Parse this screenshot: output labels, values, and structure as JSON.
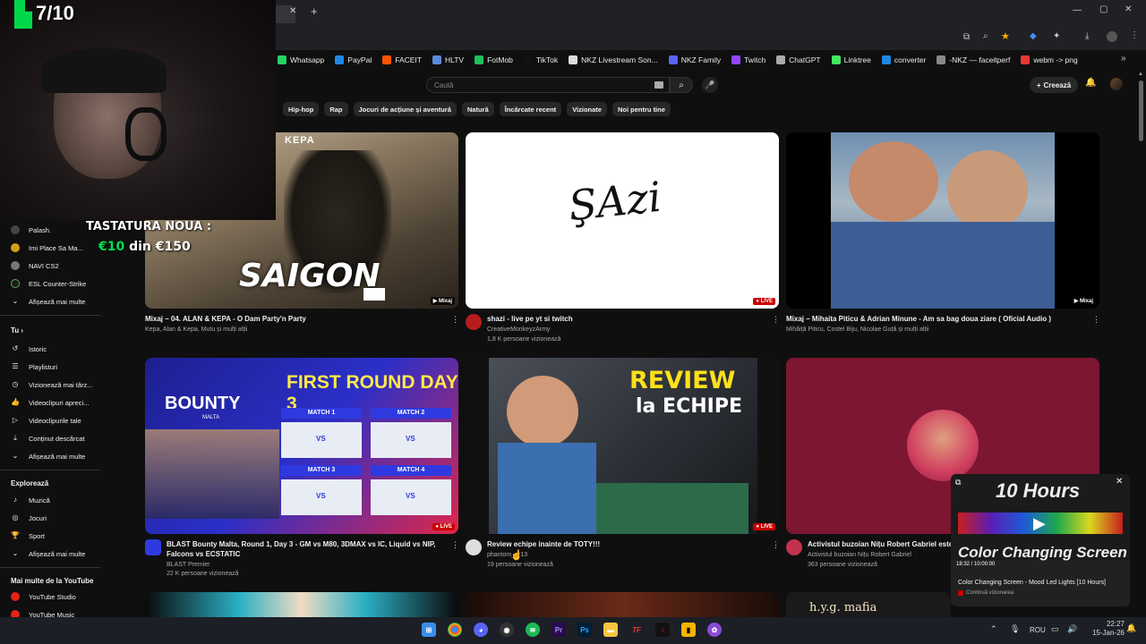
{
  "overlay": {
    "counter": "7/10",
    "keyboard_label": "TASTATURA NOUA :",
    "keyboard_amount": "€10",
    "keyboard_of": "din €150"
  },
  "browser": {
    "bookmarks": [
      {
        "label": "Whatsapp",
        "color": "#25d366"
      },
      {
        "label": "PayPal",
        "color": "#1e88e5"
      },
      {
        "label": "FACEIT",
        "color": "#ff5500"
      },
      {
        "label": "HLTV",
        "color": "#5b8bd9"
      },
      {
        "label": "FotMob",
        "color": "#20c05c"
      },
      {
        "label": "TikTok",
        "color": "#111111"
      },
      {
        "label": "NKZ Livestream Son...",
        "color": "#dddddd"
      },
      {
        "label": "NKZ Family",
        "color": "#5865f2"
      },
      {
        "label": "Twitch",
        "color": "#9146ff"
      },
      {
        "label": "ChatGPT",
        "color": "#aaaaaa"
      },
      {
        "label": "Linktree",
        "color": "#43e660"
      },
      {
        "label": "converter",
        "color": "#1e88e5"
      },
      {
        "label": "-NKZ — faceitperf",
        "color": "#888888"
      },
      {
        "label": "webm -> png",
        "color": "#e53935"
      }
    ]
  },
  "header": {
    "search_placeholder": "Caută",
    "create_label": "Creează"
  },
  "chips": [
    "Hip-hop",
    "Rap",
    "Jocuri de acțiune și aventură",
    "Natură",
    "Încărcate recent",
    "Vizionate",
    "Noi pentru tine"
  ],
  "sidebar": {
    "subscriptions": [
      {
        "label": "Palash."
      },
      {
        "label": "Imi Place Sa Ma..."
      },
      {
        "label": "NAVI CS2"
      },
      {
        "label": "ESL Counter-Strike"
      }
    ],
    "show_more": "Afișează mai multe",
    "you_header": "Tu",
    "you_items": [
      {
        "label": "Istoric",
        "icon": "history-icon",
        "glyph": "↺"
      },
      {
        "label": "Playlisturi",
        "icon": "playlist-icon",
        "glyph": "☰"
      },
      {
        "label": "Vizionează mai târz...",
        "icon": "clock-icon",
        "glyph": "◷"
      },
      {
        "label": "Videoclipuri apreci...",
        "icon": "like-icon",
        "glyph": "👍"
      },
      {
        "label": "Videoclipurile tale",
        "icon": "video-icon",
        "glyph": "▷"
      },
      {
        "label": "Conținut descărcat",
        "icon": "download-icon",
        "glyph": "⤓"
      }
    ],
    "explore_header": "Explorează",
    "explore_items": [
      {
        "label": "Muzică",
        "icon": "music-icon",
        "glyph": "♪"
      },
      {
        "label": "Jocuri",
        "icon": "gaming-icon",
        "glyph": "◎"
      },
      {
        "label": "Sport",
        "icon": "trophy-icon",
        "glyph": "🏆"
      }
    ],
    "more_header": "Mai multe de la YouTube",
    "more_items": [
      {
        "label": "YouTube Studio"
      },
      {
        "label": "YouTube Music"
      }
    ]
  },
  "videos": [
    {
      "title": "Mixaj – 04. ALAN & KEPA - O Dam Party'n Party",
      "channel": "Kepa, Alan & Kepa, Mutu și mulți alții",
      "views": "",
      "badge": "Mixaj",
      "thumb_title": "SAIGON",
      "thumb_logo": "KEPA"
    },
    {
      "title": "shazi - live pe yt si twitch",
      "channel": "CreativeMonkeyzArmy",
      "views": "1,8 K persoane vizionează",
      "badge": "LIVE",
      "thumb_text": "ŞAzi"
    },
    {
      "title": "Mixaj – Mihaita Piticu & Adrian Minune - Am sa bag doua ziare ( Oficial Audio )",
      "channel": "Mihăiță Piticu, Costel Biju, Nicolae Guță și mulți alții",
      "views": "",
      "badge": "Mixaj"
    },
    {
      "title": "BLAST Bounty Malta, Round 1, Day 3 - GM vs M80, 3DMAX vs IC, Liquid vs NIP, Falcons vs ECSTATIC",
      "channel": "BLAST Premier",
      "views": "22 K persoane vizionează",
      "badge": "LIVE",
      "thumb_brand": "BOUNTY",
      "thumb_sub": "MALTA",
      "thumb_headline": "FIRST ROUND DAY 3",
      "matches": [
        "MATCH 1",
        "MATCH 2",
        "MATCH 3",
        "MATCH 4"
      ],
      "vs": "VS"
    },
    {
      "title": "Review echipe inainte de TOTY!!!",
      "channel": "phantom_ar13",
      "views": "19 persoane vizionează",
      "badge": "LIVE",
      "thumb_line1": "REVIEW",
      "thumb_line2": "la ECHIPE"
    },
    {
      "title": "Activistul buzoian Nițu Robert Gabriel  este li",
      "channel": "Activistul buzoian Nițu Robert Gabriel",
      "views": "363 persoane vizionează",
      "badge": "LIVE"
    }
  ],
  "miniplayer": {
    "headline": "10 Hours",
    "subline": "Color Changing Screen",
    "time": "18:32 / 10:00:00",
    "title": "Color Changing Screen - Mood Led Lights [10 Hours]",
    "status": "Continuă vizionarea"
  },
  "bottom_row": {
    "partial_text": "h.y.g. mafia"
  },
  "taskbar": {
    "lang": "ROU",
    "time": "22:27",
    "date": "15-Jan-26"
  }
}
